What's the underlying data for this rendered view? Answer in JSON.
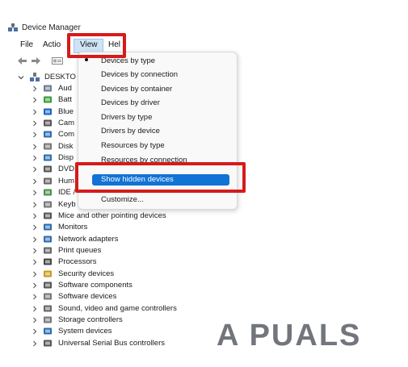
{
  "window": {
    "title": "Device Manager"
  },
  "menubar": {
    "items": [
      "File",
      "Action",
      "View",
      "Help"
    ],
    "visible_text": {
      "file": "File",
      "action": "Actio",
      "view": "View",
      "help": "Hel"
    }
  },
  "tree": {
    "root": "DESKTO",
    "categories": [
      {
        "label": "Aud",
        "icon": "speaker-icon"
      },
      {
        "label": "Batt",
        "icon": "battery-icon"
      },
      {
        "label": "Blue",
        "icon": "bluetooth-icon"
      },
      {
        "label": "Cam",
        "icon": "camera-icon"
      },
      {
        "label": "Com",
        "icon": "computer-icon"
      },
      {
        "label": "Disk",
        "icon": "disk-icon"
      },
      {
        "label": "Disp",
        "icon": "display-icon"
      },
      {
        "label": "DVD",
        "icon": "dvd-icon"
      },
      {
        "label": "Hum",
        "icon": "hid-icon"
      },
      {
        "label": "IDE /",
        "icon": "ide-icon"
      },
      {
        "label": "Keyb",
        "icon": "keyboard-icon"
      },
      {
        "label": "Mice and other pointing devices",
        "icon": "mouse-icon"
      },
      {
        "label": "Monitors",
        "icon": "monitor-icon"
      },
      {
        "label": "Network adapters",
        "icon": "network-icon"
      },
      {
        "label": "Print queues",
        "icon": "printer-icon"
      },
      {
        "label": "Processors",
        "icon": "processor-icon"
      },
      {
        "label": "Security devices",
        "icon": "security-icon"
      },
      {
        "label": "Software components",
        "icon": "software-components-icon"
      },
      {
        "label": "Software devices",
        "icon": "software-devices-icon"
      },
      {
        "label": "Sound, video and game controllers",
        "icon": "sound-icon"
      },
      {
        "label": "Storage controllers",
        "icon": "storage-icon"
      },
      {
        "label": "System devices",
        "icon": "system-icon"
      },
      {
        "label": "Universal Serial Bus controllers",
        "icon": "usb-icon"
      }
    ]
  },
  "view_menu": {
    "items": [
      "Devices by type",
      "Devices by connection",
      "Devices by container",
      "Devices by driver",
      "Drivers by type",
      "Drivers by device",
      "Resources by type",
      "Resources by connection",
      "Show hidden devices",
      "Customize..."
    ],
    "checked": "Devices by type",
    "highlighted": "Show hidden devices"
  },
  "colors": {
    "highlight": "#1173d4",
    "annotation_red": "#d61a1a"
  },
  "watermark": "A  PUALS"
}
